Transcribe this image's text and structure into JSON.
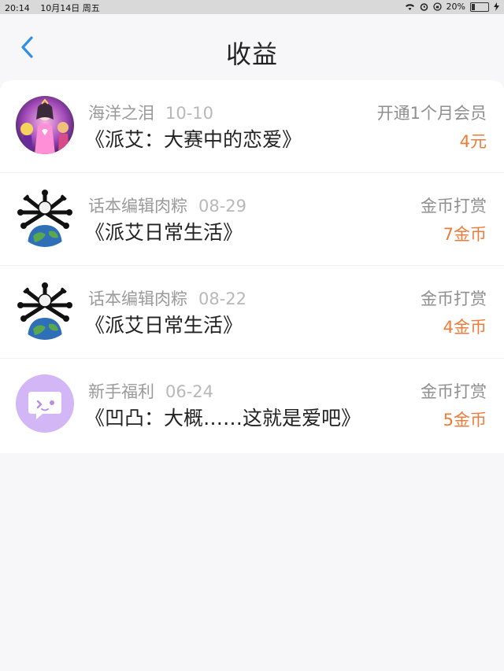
{
  "status_bar": {
    "time": "20:14",
    "date": "10月14日 周五",
    "battery": "20%",
    "battery_level": 0.2
  },
  "header": {
    "title": "收益"
  },
  "colors": {
    "accent_blue": "#2f8fe6",
    "amount_orange": "#ee7b3a"
  },
  "income_list": [
    {
      "source": "海洋之泪",
      "date": "10-10",
      "title": "《派艾：大赛中的恋爱》",
      "type": "开通1个月会员",
      "amount": "4元",
      "avatar_icon": "anime-girl-avatar-icon"
    },
    {
      "source": "话本编辑肉粽",
      "date": "08-29",
      "title": "《派艾日常生活》",
      "type": "金币打赏",
      "amount": "7金币",
      "avatar_icon": "bones-earth-avatar-icon"
    },
    {
      "source": "话本编辑肉粽",
      "date": "08-22",
      "title": "《派艾日常生活》",
      "type": "金币打赏",
      "amount": "4金币",
      "avatar_icon": "bones-earth-avatar-icon"
    },
    {
      "source": "新手福利",
      "date": "06-24",
      "title": "《凹凸：大概……这就是爱吧》",
      "type": "金币打赏",
      "amount": "5金币",
      "avatar_icon": "chat-bubble-avatar-icon"
    }
  ]
}
